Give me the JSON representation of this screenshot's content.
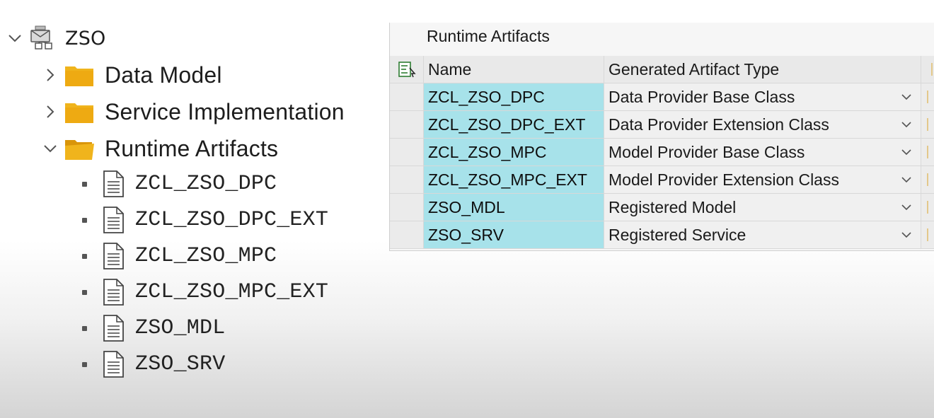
{
  "tree": {
    "root": {
      "label": "ZSO",
      "icon": "service-project-icon",
      "expanded": true
    },
    "folders": [
      {
        "label": "Data Model",
        "expanded": false,
        "icon": "folder-icon"
      },
      {
        "label": "Service Implementation",
        "expanded": false,
        "icon": "folder-icon"
      },
      {
        "label": "Runtime Artifacts",
        "expanded": true,
        "icon": "folder-open-icon"
      }
    ],
    "artifacts": [
      {
        "label": "ZCL_ZSO_DPC",
        "icon": "document-icon"
      },
      {
        "label": "ZCL_ZSO_DPC_EXT",
        "icon": "document-icon"
      },
      {
        "label": "ZCL_ZSO_MPC",
        "icon": "document-icon"
      },
      {
        "label": "ZCL_ZSO_MPC_EXT",
        "icon": "document-icon"
      },
      {
        "label": "ZSO_MDL",
        "icon": "document-icon"
      },
      {
        "label": "ZSO_SRV",
        "icon": "document-icon"
      }
    ]
  },
  "panel": {
    "title": "Runtime Artifacts",
    "columns": {
      "name": "Name",
      "type": "Generated Artifact Type"
    },
    "rows": [
      {
        "name": "ZCL_ZSO_DPC",
        "type": "Data Provider Base Class"
      },
      {
        "name": "ZCL_ZSO_DPC_EXT",
        "type": "Data Provider Extension Class"
      },
      {
        "name": "ZCL_ZSO_MPC",
        "type": "Model Provider Base Class"
      },
      {
        "name": "ZCL_ZSO_MPC_EXT",
        "type": "Model Provider Extension Class"
      },
      {
        "name": "ZSO_MDL",
        "type": "Registered Model"
      },
      {
        "name": "ZSO_SRV",
        "type": "Registered Service"
      }
    ]
  },
  "colors": {
    "folder": "#f0b41c",
    "name_cell": "#a7e2ea",
    "grid_bg": "#f0f0f0",
    "header_bg": "#e9e9e9"
  }
}
